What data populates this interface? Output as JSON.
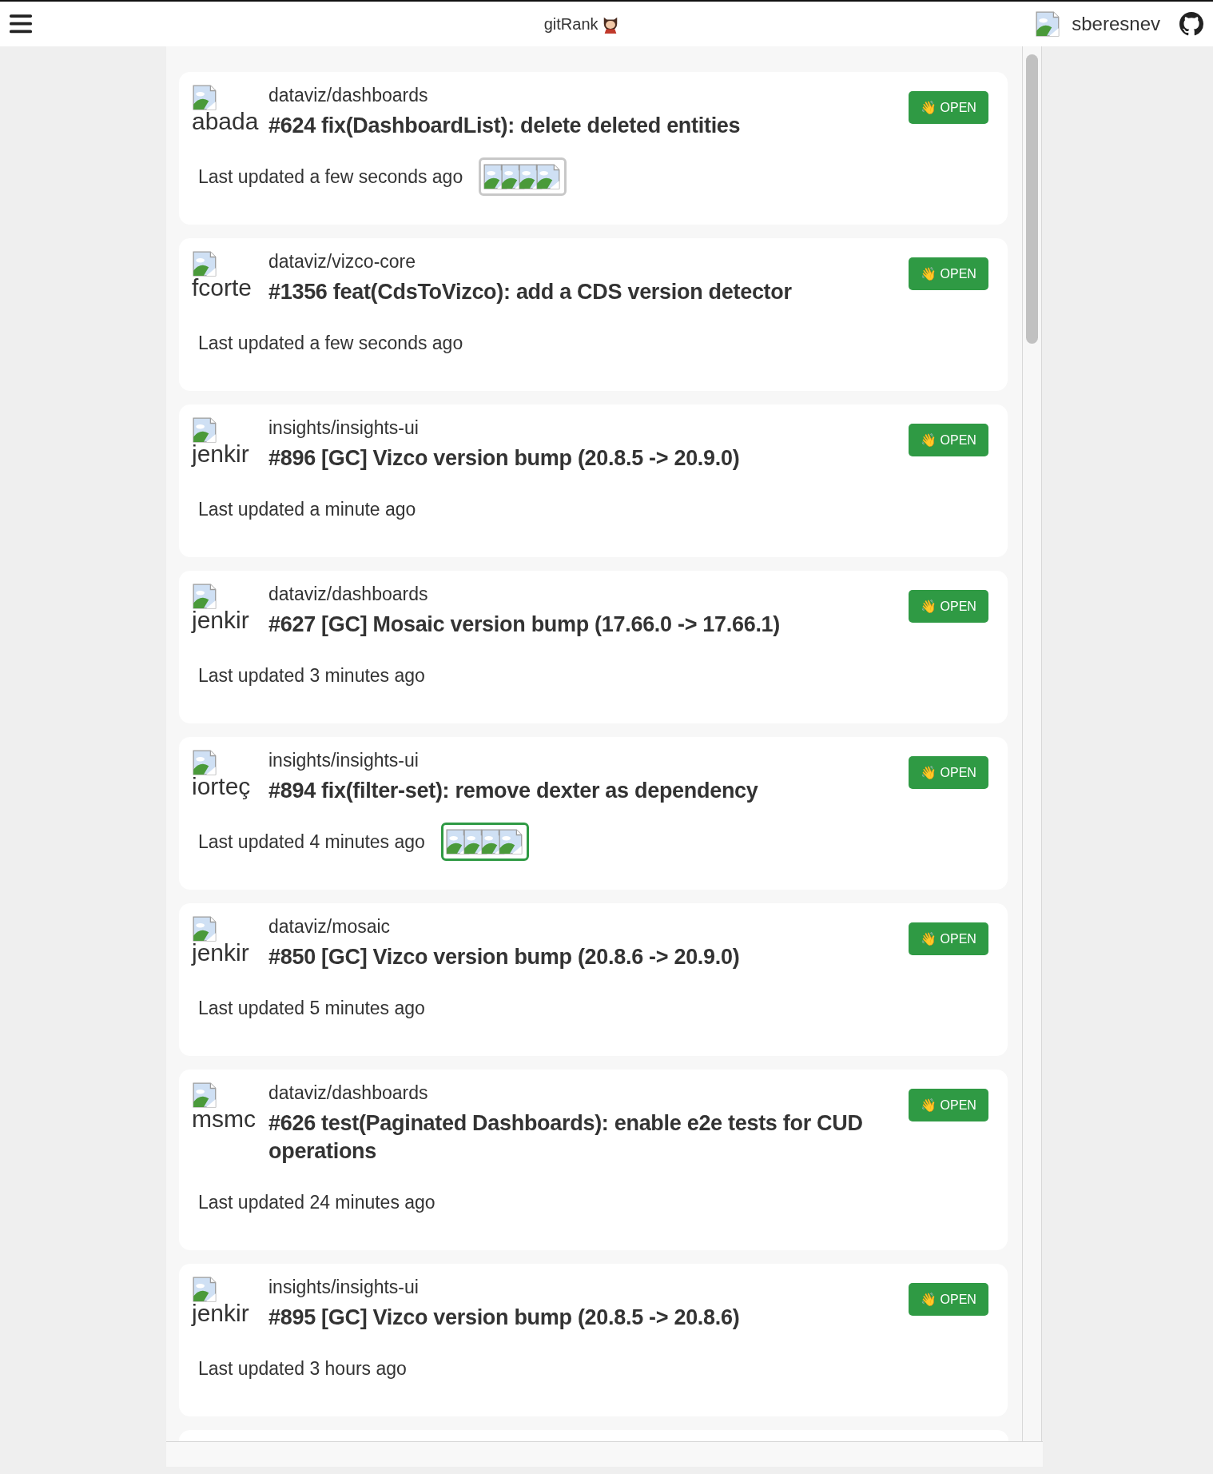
{
  "header": {
    "app_name": "gitRank",
    "username": "sberesnev"
  },
  "pull_requests": [
    {
      "avatar_alt": "abada",
      "repo": "dataviz/dashboards",
      "title": "#624 fix(DashboardList): delete deleted entities",
      "status": "👋 OPEN",
      "updated": "Last updated a few seconds ago",
      "approved": false,
      "reviewers": [
        {
          "kind": "broken_image"
        },
        {
          "kind": "broken_image"
        },
        {
          "kind": "broken_image"
        },
        {
          "kind": "broken_image"
        }
      ]
    },
    {
      "avatar_alt": "fcorte",
      "repo": "dataviz/vizco-core",
      "title": "#1356 feat(CdsToVizco): add a CDS version detector",
      "status": "👋 OPEN",
      "updated": "Last updated a few seconds ago"
    },
    {
      "avatar_alt": "jenkir",
      "repo": "insights/insights-ui",
      "title": "#896 [GC] Vizco version bump (20.8.5 -> 20.9.0)",
      "status": "👋 OPEN",
      "updated": "Last updated a minute ago"
    },
    {
      "avatar_alt": "jenkir",
      "repo": "dataviz/dashboards",
      "title": "#627 [GC] Mosaic version bump (17.66.0 -> 17.66.1)",
      "status": "👋 OPEN",
      "updated": "Last updated 3 minutes ago"
    },
    {
      "avatar_alt": "iorteç",
      "repo": "insights/insights-ui",
      "title": "#894 fix(filter-set): remove dexter as dependency",
      "status": "👋 OPEN",
      "updated": "Last updated 4 minutes ago",
      "approved": true,
      "reviewers": [
        {
          "kind": "broken_image"
        },
        {
          "kind": "broken_image"
        },
        {
          "kind": "broken_image"
        },
        {
          "kind": "broken_image"
        }
      ]
    },
    {
      "avatar_alt": "jenkir",
      "repo": "dataviz/mosaic",
      "title": "#850 [GC] Vizco version bump (20.8.6 -> 20.9.0)",
      "status": "👋 OPEN",
      "updated": "Last updated 5 minutes ago"
    },
    {
      "avatar_alt": "msmc",
      "repo": "dataviz/dashboards",
      "title": "#626 test(Paginated Dashboards): enable e2e tests for CUD operations",
      "status": "👋 OPEN",
      "updated": "Last updated 24 minutes ago"
    },
    {
      "avatar_alt": "jenkir",
      "repo": "insights/insights-ui",
      "title": "#895 [GC] Vizco version bump (20.8.5 -> 20.8.6)",
      "status": "👋 OPEN",
      "updated": "Last updated 3 hours ago"
    }
  ]
}
